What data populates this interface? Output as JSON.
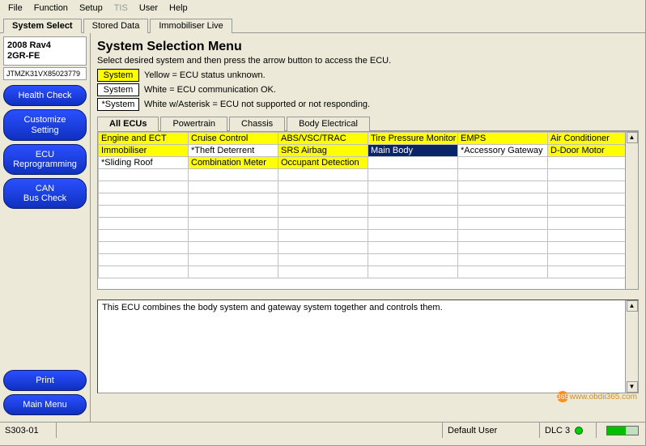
{
  "menu": [
    "File",
    "Function",
    "Setup",
    "TIS",
    "User",
    "Help"
  ],
  "menu_disabled_index": 3,
  "top_tabs": [
    {
      "label": "System Select",
      "active": true
    },
    {
      "label": "Stored Data",
      "active": false
    },
    {
      "label": "Immobiliser Live",
      "active": false
    }
  ],
  "vehicle": {
    "line1": "2008 Rav4",
    "line2": "2GR-FE"
  },
  "vin": "JTMZK31VX85023779",
  "sidebar_buttons": [
    "Health Check",
    "Customize\nSetting",
    "ECU\nReprogramming",
    "CAN\nBus Check"
  ],
  "sidebar_bottom": [
    "Print",
    "Main Menu"
  ],
  "main": {
    "title": "System Selection Menu",
    "subtitle": "Select desired system and then press the arrow button to access the ECU.",
    "legend": [
      {
        "swatch": "System",
        "swatch_class": "sw-yellow",
        "text": "Yellow = ECU status unknown."
      },
      {
        "swatch": "System",
        "swatch_class": "sw-white",
        "text": "White = ECU communication OK."
      },
      {
        "swatch": "*System",
        "swatch_class": "sw-white",
        "text": "White w/Asterisk = ECU not supported or not responding."
      }
    ],
    "subtabs": [
      {
        "label": "All ECUs",
        "active": true
      },
      {
        "label": "Powertrain",
        "active": false
      },
      {
        "label": "Chassis",
        "active": false
      },
      {
        "label": "Body Electrical",
        "active": false
      }
    ],
    "grid_cols": 6,
    "grid_rows": 12,
    "grid": [
      [
        {
          "t": "Engine and ECT",
          "s": "yellow"
        },
        {
          "t": "Cruise Control",
          "s": "yellow"
        },
        {
          "t": "ABS/VSC/TRAC",
          "s": "yellow"
        },
        {
          "t": "Tire Pressure Monitor",
          "s": "yellow"
        },
        {
          "t": "EMPS",
          "s": "yellow"
        },
        {
          "t": "Air Conditioner",
          "s": "yellow"
        }
      ],
      [
        {
          "t": "Immobiliser",
          "s": "yellow"
        },
        {
          "t": "*Theft Deterrent",
          "s": ""
        },
        {
          "t": "SRS Airbag",
          "s": "yellow"
        },
        {
          "t": "Main Body",
          "s": "sel"
        },
        {
          "t": "*Accessory Gateway",
          "s": ""
        },
        {
          "t": "D-Door Motor",
          "s": "yellow"
        }
      ],
      [
        {
          "t": "*Sliding Roof",
          "s": ""
        },
        {
          "t": "Combination Meter",
          "s": "yellow"
        },
        {
          "t": "Occupant Detection",
          "s": "yellow"
        },
        {
          "t": "",
          "s": ""
        },
        {
          "t": "",
          "s": ""
        },
        {
          "t": "",
          "s": ""
        }
      ]
    ],
    "info": "This ECU combines the body system and gateway system together and controls them."
  },
  "status": {
    "left": "S303-01",
    "user": "Default User",
    "dlc": "DLC 3"
  },
  "watermark": "www.obdii365.com"
}
